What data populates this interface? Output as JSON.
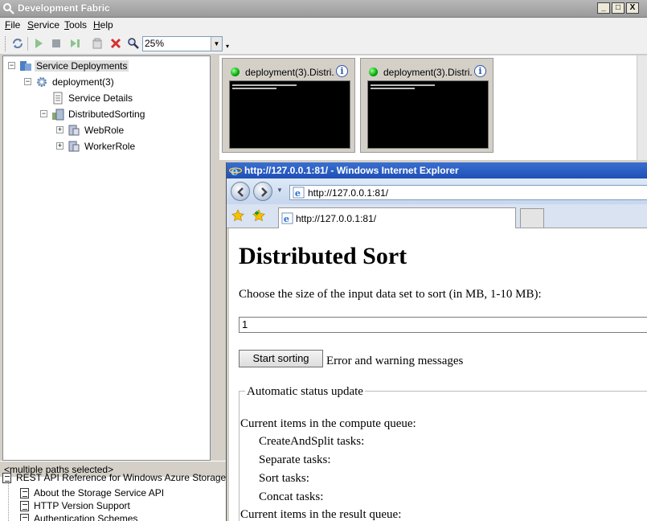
{
  "devfabric": {
    "title": "Development Fabric",
    "window_buttons": {
      "minimize": "_",
      "maximize": "□",
      "close": "X"
    },
    "menu": [
      {
        "label_acc": "F",
        "label_rest": "ile"
      },
      {
        "label_acc": "S",
        "label_rest": "ervice"
      },
      {
        "label_acc": "T",
        "label_rest": "ools"
      },
      {
        "label_acc": "H",
        "label_rest": "elp"
      }
    ],
    "toolbar": {
      "zoom_value": "25%"
    },
    "tree": {
      "root": "Service Deployments",
      "deployment": "deployment(3)",
      "service_details": "Service Details",
      "distributed_sorting": "DistributedSorting",
      "web_role": "WebRole",
      "worker_role": "WorkerRole"
    },
    "status": "<multiple paths selected>",
    "thumbnails": [
      {
        "label": "deployment(3).Distri..."
      },
      {
        "label": "deployment(3).Distri..."
      }
    ]
  },
  "help_list": {
    "items": [
      "REST API Reference for Windows Azure Storage Serv",
      "About the Storage Service API",
      "HTTP Version Support",
      "Authentication Schemes"
    ]
  },
  "ie": {
    "title": "http://127.0.0.1:81/ - Windows Internet Explorer",
    "address": "http://127.0.0.1:81/",
    "tab_label": "http://127.0.0.1:81/",
    "page": {
      "heading": "Distributed Sort",
      "prompt": "Choose the size of the input data set to sort (in MB, 1-10 MB):",
      "input_value": "1",
      "button": "Start sorting",
      "error_text": "Error and warning messages",
      "status_legend": "Automatic status update",
      "compute_queue_label": "Current items in the compute queue:",
      "tasks": [
        "CreateAndSplit tasks:",
        "Separate tasks:",
        "Sort tasks:",
        "Concat tasks:"
      ],
      "result_queue_label": "Current items in the result queue:"
    }
  },
  "colors": {
    "ie_title_bar": "#1f4fb6",
    "status_dot": "#00aa00",
    "console_bg": "#000000"
  }
}
